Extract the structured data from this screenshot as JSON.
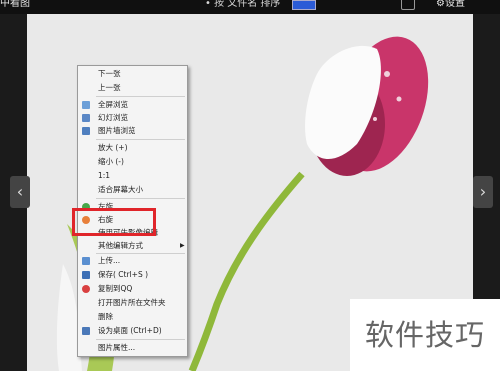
{
  "topbar": {
    "title": "中看图",
    "sort_label": "• 按 文件名 排序",
    "settings_label": "⚙设置"
  },
  "context_menu": {
    "items": {
      "next": "下一张",
      "prev": "上一张",
      "fullscreen": "全屏浏览",
      "slideshow": "幻灯浏览",
      "wall": "图片墙浏览",
      "zoom_in": "放大 (+)",
      "zoom_out": "缩小 (-)",
      "actual": "1:1",
      "fit": "适合屏幕大小",
      "rotate_left": "左旋",
      "rotate_right": "右旋",
      "edit_with": "使用可牛影像编辑",
      "other_edit": "其他编辑方式",
      "upload": "上传...",
      "save": "保存( Ctrl+S )",
      "copy_qq": "复制到QQ",
      "open_folder": "打开图片所在文件夹",
      "delete": "删除",
      "set_desktop": "设为桌面     (Ctrl+D)",
      "properties": "图片属性..."
    }
  },
  "watermark": "软件技巧",
  "colors": {
    "highlight": "#e0252a",
    "tulip": "#c9356a",
    "stem": "#8fb83a",
    "background": "#e9e9e9"
  },
  "icons": [
    "fullscreen-icon",
    "slideshow-icon",
    "image-wall-icon",
    "rotate-left-icon",
    "rotate-right-icon",
    "upload-icon",
    "save-icon",
    "qq-icon",
    "desktop-icon"
  ]
}
